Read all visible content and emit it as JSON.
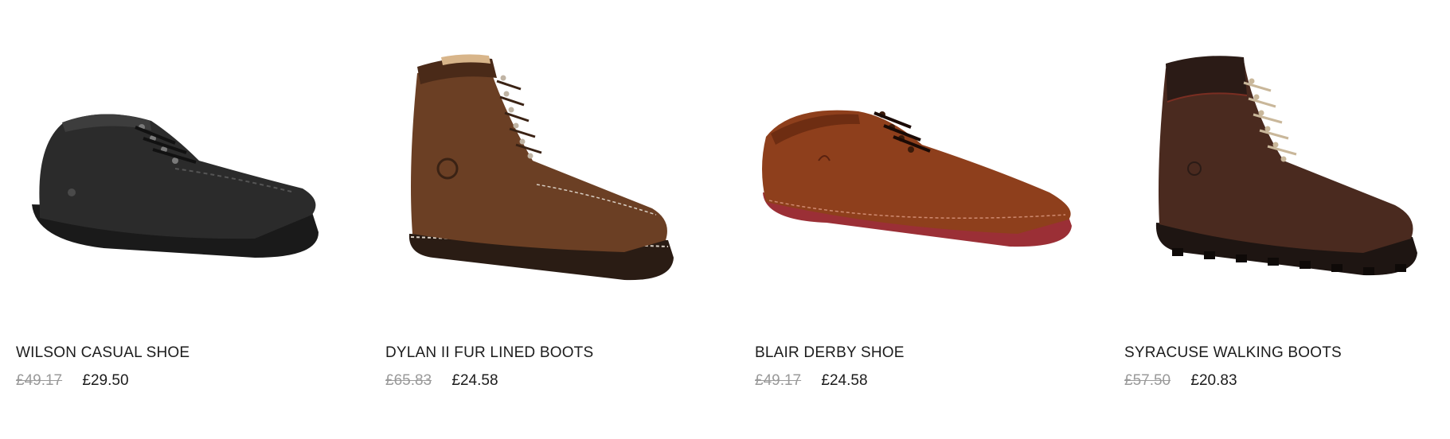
{
  "products": [
    {
      "name": "WILSON CASUAL SHOE",
      "was_price": "£49.17",
      "price": "£29.50",
      "image": "black-leather-casual-shoe",
      "colors": {
        "upper": "#2b2b2b",
        "sole": "#1a1a1a",
        "accent": "#3d3d3d"
      }
    },
    {
      "name": "DYLAN II FUR LINED BOOTS",
      "was_price": "£65.83",
      "price": "£24.58",
      "image": "brown-nubuck-fur-lined-boot",
      "colors": {
        "upper": "#6b3f24",
        "sole": "#2a1c14",
        "accent": "#4a2a18"
      }
    },
    {
      "name": "BLAIR DERBY SHOE",
      "was_price": "£49.17",
      "price": "£24.58",
      "image": "tan-leather-derby-shoe",
      "colors": {
        "upper": "#8e3f1c",
        "sole": "#9b2f36",
        "accent": "#6e2d12"
      }
    },
    {
      "name": "SYRACUSE WALKING BOOTS",
      "was_price": "£57.50",
      "price": "£20.83",
      "image": "dark-brown-walking-boot",
      "colors": {
        "upper": "#4a2a1f",
        "sole": "#1e1512",
        "accent": "#2b1b16"
      }
    }
  ]
}
